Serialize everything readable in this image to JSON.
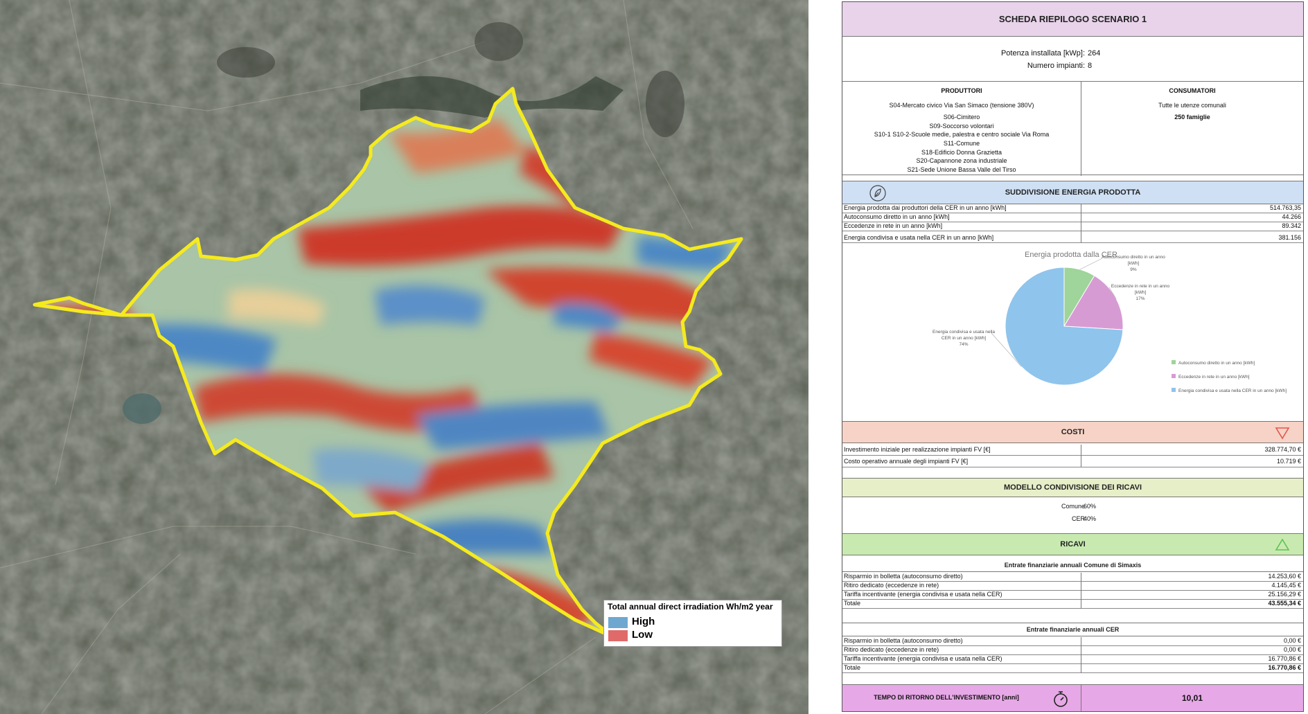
{
  "map": {
    "legend": {
      "title": "Total annual direct irradiation Wh/m2 year",
      "high_label": "High",
      "low_label": "Low",
      "high_color": "#6ea8d0",
      "low_color": "#e06a6a"
    },
    "boundary_color": "#f5ea1e"
  },
  "sheet": {
    "title": "SCHEDA RIEPILOGO SCENARIO 1",
    "params": [
      {
        "label": "Potenza installata [kWp]:",
        "value": "264"
      },
      {
        "label": "Numero impianti:",
        "value": "8"
      }
    ],
    "producers_header": "PRODUTTORI",
    "consumers_header": "CONSUMATORI",
    "producers": [
      "S04-Mercato civico Via San Simaco (tensione 380V)",
      "S06-Cimitero",
      "S09-Soccorso volontari",
      "S10-1  S10-2-Scuole medie, palestra e centro sociale Via Roma",
      "S11-Comune",
      "S18-Edificio Donna Grazietta",
      "S20-Capannone zona industriale",
      "S21-Sede Unione Bassa Valle del Tirso"
    ],
    "consumers": [
      "Tutte le utenze comunali",
      "250 famiglie"
    ],
    "energy_header": "SUDDIVISIONE ENERGIA PRODOTTA",
    "energy_rows": [
      {
        "label": "Energia prodotta dai produttori della CER in un anno [kWh]",
        "value": "514.763,35"
      },
      {
        "label": "Autoconsumo diretto in un anno [kWh]",
        "value": "44.266"
      },
      {
        "label": "Eccedenze in rete in un anno [kWh]",
        "value": "89.342"
      },
      {
        "label": "Energia condivisa e usata nella CER in un anno [kWh]",
        "value": "381.156"
      }
    ],
    "costs_header": "COSTI",
    "cost_rows": [
      {
        "label": "Investimento iniziale per realizzazione impianti FV [€]",
        "value": "328.774,70 €"
      },
      {
        "label": "Costo operativo annuale degli impianti FV [€]",
        "value": "10.719 €"
      }
    ],
    "sharing_header": "MODELLO CONDIVISIONE DEI RICAVI",
    "sharing_rows": [
      {
        "label": "Comune",
        "value": "60%"
      },
      {
        "label": "CER",
        "value": "40%"
      }
    ],
    "revenue_header": "RICAVI",
    "comune_header": "Entrate finanziarie annuali Comune di Simaxis",
    "comune_rows": [
      {
        "label": "Risparmio in bolletta (autoconsumo diretto)",
        "value": "14.253,60 €"
      },
      {
        "label": "Ritiro dedicato (eccedenze in rete)",
        "value": "4.145,45 €"
      },
      {
        "label": "Tariffa incentivante (energia condivisa e usata nella CER)",
        "value": "25.156,29 €"
      },
      {
        "label": "Totale",
        "value": "43.555,34 €"
      }
    ],
    "cer_header": "Entrate finanziarie annuali CER",
    "cer_rows": [
      {
        "label": "Risparmio in bolletta (autoconsumo diretto)",
        "value": "0,00 €"
      },
      {
        "label": "Ritiro dedicato (eccedenze in rete)",
        "value": "0,00 €"
      },
      {
        "label": "Tariffa incentivante (energia condivisa e usata nella CER)",
        "value": "16.770,86 €"
      },
      {
        "label": "Totale",
        "value": "16.770,86 €"
      }
    ],
    "payback_label": "TEMPO DI RITORNO DELL'INVESTIMENTO [anni]",
    "payback_value": "10,01",
    "colors": {
      "title_bg": "#e8d3ea",
      "energy_bg": "#cfe0f5",
      "costs_bg": "#f6d3c6",
      "sharing_bg": "#e7efc9",
      "revenue_bg": "#c8eab0",
      "payback_bg": "#e6a8e6"
    }
  },
  "chart_data": {
    "type": "pie",
    "title": "Energia prodotta dalla CER",
    "categories": [
      "Autoconsumo diretto in un anno [kWh]",
      "Eccedenze in rete in un anno [kWh]",
      "Energia condivisa e usata nella CER in un anno [kWh]"
    ],
    "values": [
      44266,
      89342,
      381156
    ],
    "percent_labels": [
      "9%",
      "17%",
      "74%"
    ],
    "colors": [
      "#9fd49a",
      "#d79bd4",
      "#8fc4ec"
    ],
    "legend_position": "right"
  }
}
